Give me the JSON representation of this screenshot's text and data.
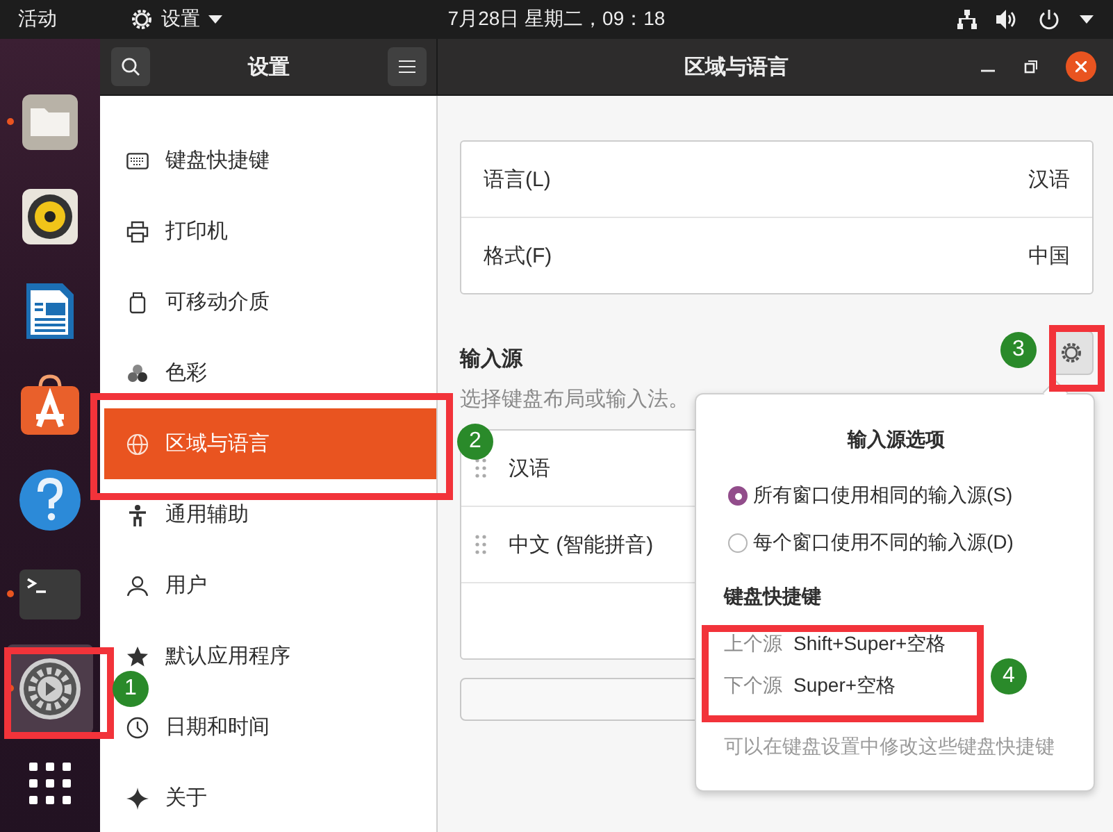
{
  "top_bar": {
    "activities": "活动",
    "app_menu": "设置",
    "clock": "7月28日 星期二，09：18"
  },
  "dock": [
    {
      "kind": "files",
      "running": true,
      "selected": false
    },
    {
      "kind": "music",
      "running": false,
      "selected": false
    },
    {
      "kind": "writer",
      "running": false,
      "selected": false
    },
    {
      "kind": "software",
      "running": false,
      "selected": false
    },
    {
      "kind": "help",
      "running": false,
      "selected": false
    },
    {
      "kind": "terminal",
      "running": true,
      "selected": false
    },
    {
      "kind": "settings",
      "running": true,
      "selected": true
    },
    {
      "kind": "apps",
      "running": false,
      "selected": false
    }
  ],
  "header": {
    "sidebar_title": "设置",
    "page_title": "区域与语言"
  },
  "sidebar": {
    "items": [
      {
        "label": "键盘快捷键",
        "selected": false
      },
      {
        "label": "打印机",
        "selected": false
      },
      {
        "label": "可移动介质",
        "selected": false
      },
      {
        "label": "色彩",
        "selected": false
      },
      {
        "label": "区域与语言",
        "selected": true
      },
      {
        "label": "通用辅助",
        "selected": false
      },
      {
        "label": "用户",
        "selected": false
      },
      {
        "label": "默认应用程序",
        "selected": false
      },
      {
        "label": "日期和时间",
        "selected": false
      },
      {
        "label": "关于",
        "selected": false
      }
    ]
  },
  "language_card": [
    {
      "label": "语言(L)",
      "value": "汉语"
    },
    {
      "label": "格式(F)",
      "value": "中国"
    }
  ],
  "input_sources": {
    "heading": "输入源",
    "hint": "选择键盘布局或输入法。",
    "items": [
      "汉语",
      "中文 (智能拼音)"
    ]
  },
  "popup": {
    "title": "输入源选项",
    "options": [
      {
        "label": "所有窗口使用相同的输入源(S)",
        "selected": true
      },
      {
        "label": "每个窗口使用不同的输入源(D)",
        "selected": false
      }
    ],
    "shortcuts_heading": "键盘快捷键",
    "shortcuts": [
      {
        "label": "上个源",
        "keys": "Shift+Super+空格"
      },
      {
        "label": "下个源",
        "keys": "Super+空格"
      }
    ],
    "note": "可以在键盘设置中修改这些键盘快捷键"
  },
  "annotations": [
    {
      "number": "1"
    },
    {
      "number": "2"
    },
    {
      "number": "3"
    },
    {
      "number": "4"
    }
  ]
}
